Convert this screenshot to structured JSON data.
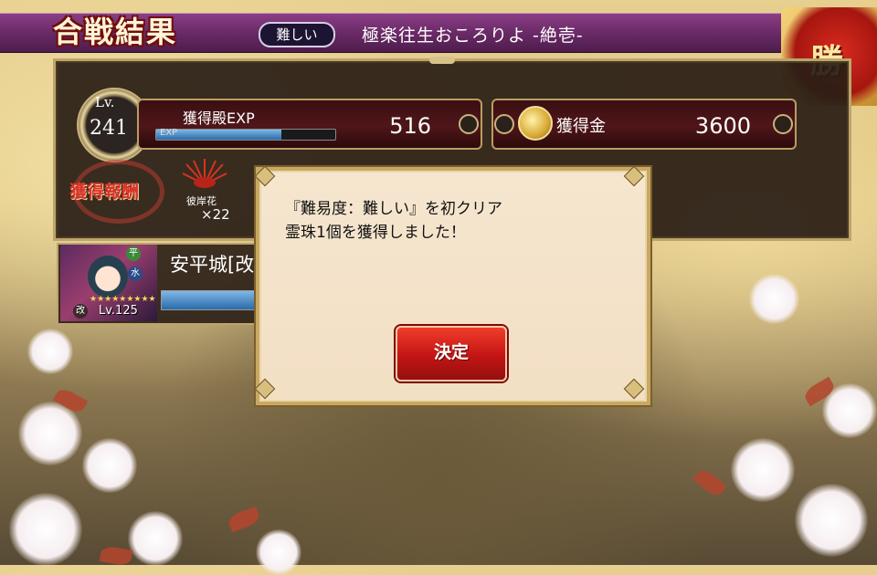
{
  "header": {
    "title": "合戦結果",
    "difficulty_badge": "難しい",
    "stage_name": "極楽往生おころりよ -絶壱-",
    "win_seal": "勝"
  },
  "results": {
    "level_label": "Lv.",
    "level_value": "241",
    "exp_label": "獲得殿EXP",
    "exp_gauge_label": "EXP",
    "exp_gauge_fraction": 0.7,
    "exp_value": "516",
    "gold_label": "獲得金",
    "gold_value": "3600",
    "reward_label": "獲得報酬",
    "reward_item_name": "彼岸花",
    "reward_item_count": "×22"
  },
  "character": {
    "name": "安平城[改",
    "badge_top": "平",
    "badge_mid": "水",
    "badge_bottom": "改",
    "stars": "★★★★★★★★★",
    "level": "Lv.125",
    "gauge_fraction": 0.95
  },
  "dialog": {
    "line1": "『難易度：難しい』を初クリア",
    "line2": "霊珠1個を獲得しました！",
    "confirm_label": "決定"
  },
  "colors": {
    "banner": "#6a2a67",
    "confirm_button": "#c31414",
    "dialog_bg": "#f4e3ca",
    "panel_bg": "#2a1e16"
  }
}
